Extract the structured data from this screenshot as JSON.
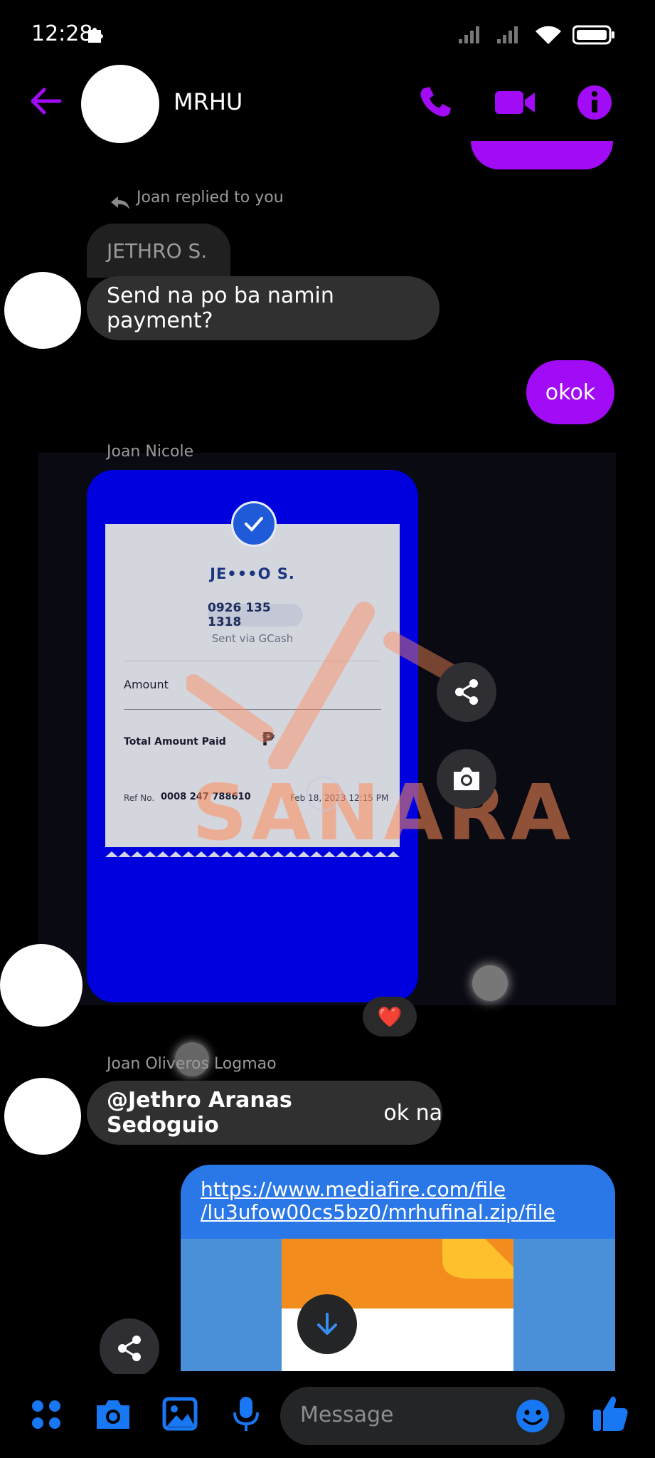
{
  "status_bar": {
    "time": "12:28"
  },
  "header": {
    "title": "MRHU"
  },
  "thread": {
    "reply_meta": "Joan replied to you",
    "quoted_text": "JETHRO S.",
    "incoming_message_1": "Send na po ba namin payment?",
    "outgoing_message_1": "okok",
    "sender_2": "Joan Nicole",
    "receipt": {
      "name": "JE•••O S.",
      "phone": "0926 135 1318",
      "sent_via": "Sent via GCash",
      "amount_label": "Amount",
      "total_label": "Total Amount Paid",
      "currency_symbol": "₱",
      "ref_label": "Ref No.",
      "ref_no": "0008 247 788610",
      "datetime": "Feb 18, 2023 12:15 PM",
      "watermark": "SANARA"
    },
    "reaction": "❤️",
    "sender_3": "Joan Oliveros Logmao",
    "mention": "@Jethro Aranas Sedoguio",
    "mention_suffix": " ok na",
    "link_line_1": "https://www.mediafire.com/file",
    "link_line_2": "/lu3ufow00cs5bz0/mrhufinal.zip/file"
  },
  "composer": {
    "placeholder": "Message"
  },
  "colors": {
    "accent": "#a20bf5",
    "messenger_blue": "#1877f2",
    "bubble_gray": "#303030"
  }
}
